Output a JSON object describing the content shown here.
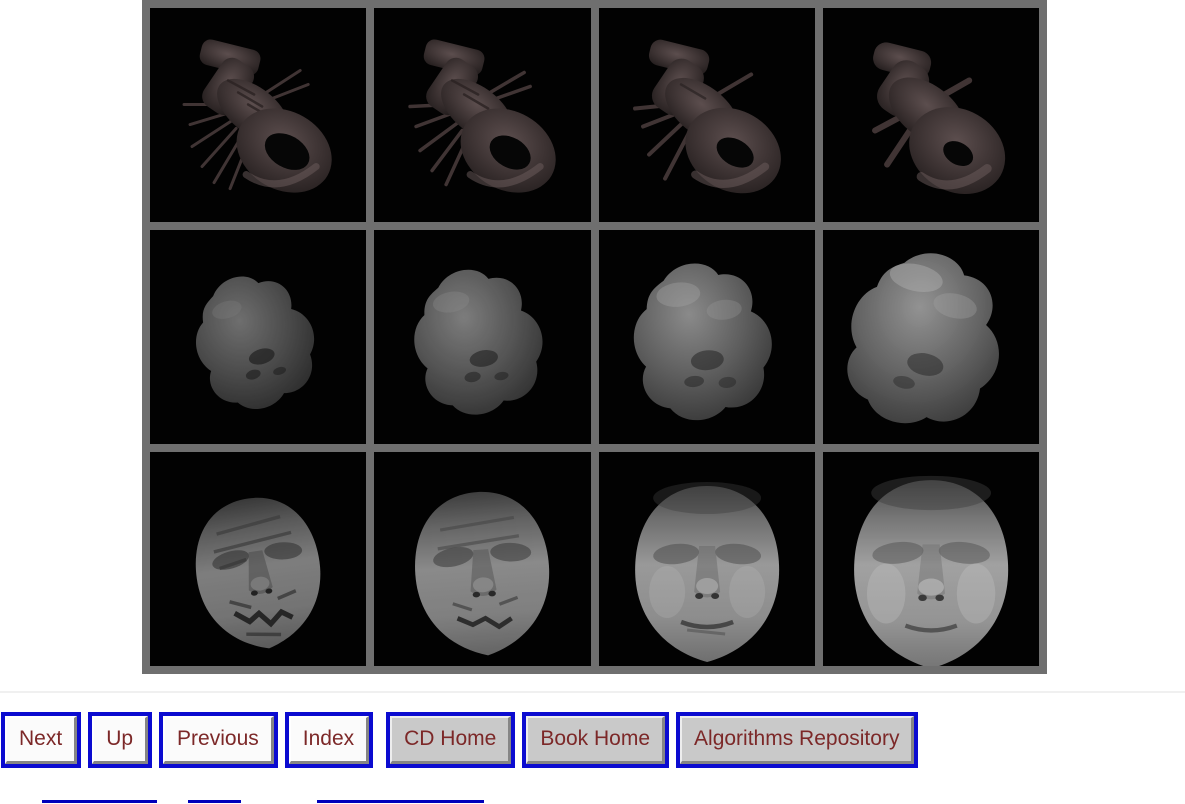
{
  "figure": {
    "name": "mesh-simplification-grid",
    "grid": {
      "columns": 4,
      "rows": 3
    },
    "frame_color": "#6f6f6f",
    "cell_background": "#020202",
    "rows": [
      {
        "model": "lobster",
        "cells": [
          "lobster-mesh-most-detailed",
          "lobster-mesh-simplified-2",
          "lobster-mesh-simplified-3",
          "lobster-mesh-least-detailed"
        ]
      },
      {
        "model": "blob",
        "cells": [
          "blob-mesh-level-1",
          "blob-mesh-level-2",
          "blob-mesh-level-3",
          "blob-mesh-level-4"
        ]
      },
      {
        "model": "face",
        "cells": [
          "face-mesh-roughest",
          "face-mesh-rough",
          "face-mesh-smooth",
          "face-mesh-smoothest"
        ]
      }
    ]
  },
  "nav": {
    "link_border_color": "#0b0bd0",
    "text_color": "#7c2828",
    "buttons": [
      {
        "label": "Next"
      },
      {
        "label": "Up"
      },
      {
        "label": "Previous"
      },
      {
        "label": "Index"
      },
      {
        "label": "CD Home"
      },
      {
        "label": "Book Home"
      },
      {
        "label": "Algorithms Repository"
      }
    ]
  },
  "footer": {
    "clipped_link_underline_color": "#0000bb",
    "clipped_link_count": 3
  }
}
